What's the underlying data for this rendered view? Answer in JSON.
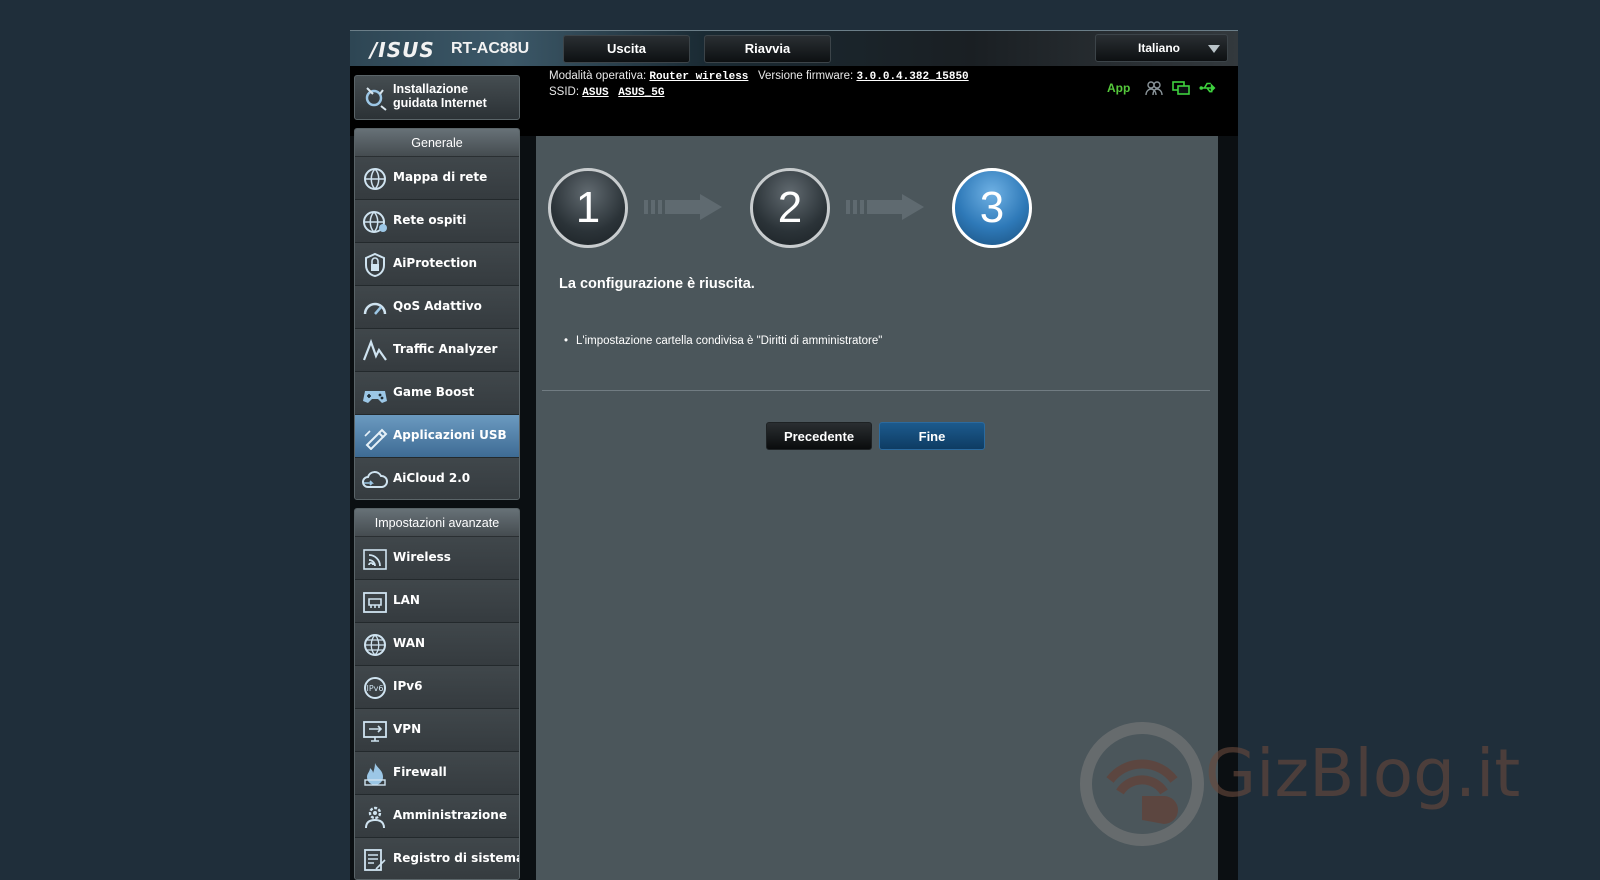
{
  "header": {
    "brand": "/ISUS",
    "model": "RT-AC88U",
    "exit_label": "Uscita",
    "reboot_label": "Riavvia",
    "language": "Italiano"
  },
  "status": {
    "mode_label": "Modalità operativa:",
    "mode_value": "Router wireless",
    "firmware_label": "Versione firmware:",
    "firmware_value": "3.0.0.4.382_15850",
    "ssid_label": "SSID:",
    "ssid_1": "ASUS",
    "ssid_2": "ASUS_5G",
    "app_label": "App"
  },
  "sidebar": {
    "qis_label": "Installazione guidata Internet",
    "general_title": "Generale",
    "general_items": [
      {
        "label": "Mappa di rete",
        "icon": "network-map-icon"
      },
      {
        "label": "Rete ospiti",
        "icon": "guest-network-icon"
      },
      {
        "label": "AiProtection",
        "icon": "lock-shield-icon"
      },
      {
        "label": "QoS Adattivo",
        "icon": "gauge-icon"
      },
      {
        "label": "Traffic Analyzer",
        "icon": "pulse-icon"
      },
      {
        "label": "Game Boost",
        "icon": "gamepad-icon"
      },
      {
        "label": "Applicazioni USB",
        "icon": "usb-app-icon"
      },
      {
        "label": "AiCloud 2.0",
        "icon": "cloud-icon"
      }
    ],
    "advanced_title": "Impostazioni avanzate",
    "advanced_items": [
      {
        "label": "Wireless",
        "icon": "wifi-icon"
      },
      {
        "label": "LAN",
        "icon": "lan-icon"
      },
      {
        "label": "WAN",
        "icon": "globe-icon"
      },
      {
        "label": "IPv6",
        "icon": "ipv6-icon"
      },
      {
        "label": "VPN",
        "icon": "vpn-icon"
      },
      {
        "label": "Firewall",
        "icon": "fire-icon"
      },
      {
        "label": "Amministrazione",
        "icon": "gear-person-icon"
      },
      {
        "label": "Registro di sistema",
        "icon": "log-icon"
      }
    ],
    "active_item": "Applicazioni USB"
  },
  "wizard": {
    "steps": [
      "1",
      "2",
      "3"
    ],
    "current_step": 3,
    "message": "La configurazione è riuscita.",
    "note": "L'impostazione cartella condivisa è \"Diritti di amministratore\"",
    "prev_label": "Precedente",
    "finish_label": "Fine"
  },
  "watermark": "GizBlog.it",
  "colors": {
    "background": "#1f2e3a",
    "content": "#4b565b",
    "active_item": "#4f80aa",
    "primary_button": "#12497a",
    "status_green": "#55c93b"
  }
}
